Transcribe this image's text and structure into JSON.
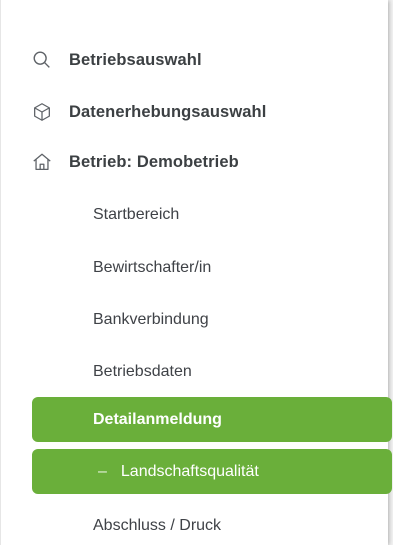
{
  "sidebar": {
    "top_items": [
      {
        "label": "Betriebsauswahl",
        "icon": "search-icon"
      },
      {
        "label": "Datenerhebungsauswahl",
        "icon": "cube-icon"
      },
      {
        "label": "Betrieb: Demobetrieb",
        "icon": "home-icon"
      }
    ],
    "sub_items": [
      {
        "label": "Startbereich"
      },
      {
        "label": "Bewirtschafter/in"
      },
      {
        "label": "Bankverbindung"
      },
      {
        "label": "Betriebsdaten"
      }
    ],
    "active_item": {
      "label": "Detailanmeldung"
    },
    "active_subitem": {
      "prefix": "–",
      "label": "Landschaftsqualität"
    },
    "footer_item": {
      "label": "Abschluss / Druck"
    }
  },
  "colors": {
    "accent": "#6aaf3a",
    "text": "#3c4043",
    "icon": "#5f6368"
  }
}
